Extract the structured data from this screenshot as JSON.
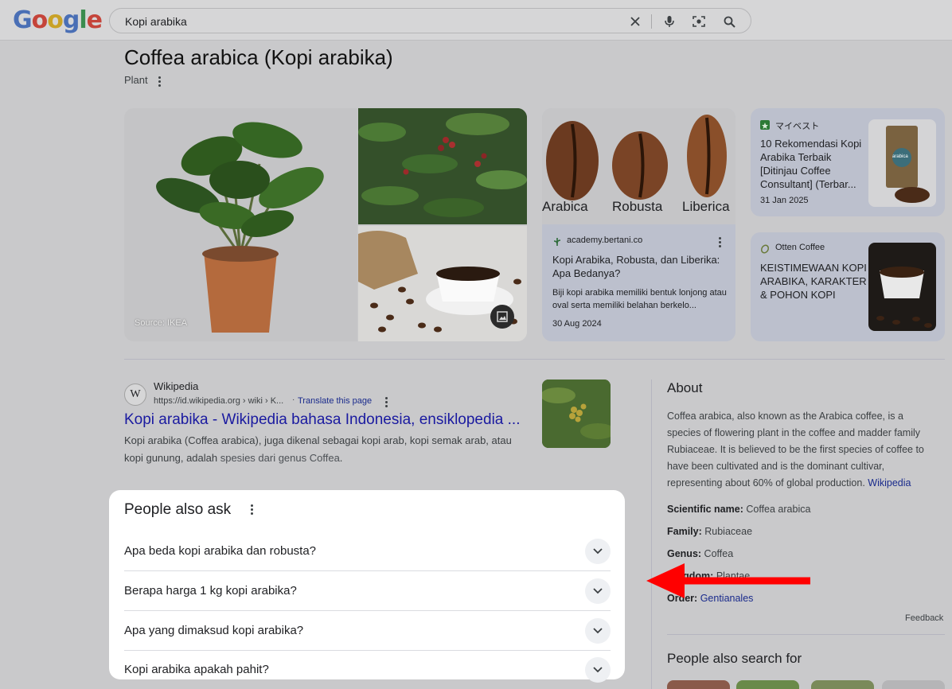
{
  "colors": {
    "overlay_bg": "#c9c9cb",
    "link": "#1a1aa0",
    "paa_bg": "#ffffff",
    "arrow": "#ff0000"
  },
  "logo": {
    "g1": "G",
    "o1": "o",
    "o2": "o",
    "g2": "g",
    "l": "l",
    "e": "e"
  },
  "search": {
    "value": "Kopi arabika",
    "icons": [
      "clear-icon",
      "mic-icon",
      "lens-icon",
      "search-icon"
    ]
  },
  "entity": {
    "title": "Coffea arabica (Kopi arabika)",
    "type": "Plant"
  },
  "image_caption": "Source: IKEA",
  "cards": [
    {
      "label_overlay": [
        "Arabica",
        "Robusta",
        "Liberica"
      ],
      "source": "academy.bertani.co",
      "title": "Kopi Arabika, Robusta, dan Liberika: Apa Bedanya?",
      "desc": "Biji kopi arabika memiliki bentuk lonjong atau oval serta memiliki belahan berkelo...",
      "date": "30 Aug 2024"
    },
    {
      "source": "マイベスト",
      "title": "10 Rekomendasi Kopi Arabika Terbaik [Ditinjau Coffee Consultant] (Terbar...",
      "date": "31 Jan 2025",
      "thumb_text": "arabica"
    },
    {
      "source": "Otten Coffee",
      "title": "KEISTIMEWAAN KOPI ARABIKA, KARAKTER & POHON KOPI"
    }
  ],
  "wiki": {
    "badge": "W",
    "site": "Wikipedia",
    "url": "https://id.wikipedia.org › wiki › K...",
    "translate": "Translate this page",
    "title": "Kopi arabika - Wikipedia bahasa Indonesia, ensiklopedia ...",
    "snippet_plain": "Kopi arabika (Coffea arabica), juga dikenal sebagai kopi arab, kopi semak arab, atau kopi gunung, adalah ",
    "snippet_bold": "spesies dari genus Coffea",
    "snippet_end": "."
  },
  "paa": {
    "heading": "People also ask",
    "questions": [
      "Apa beda kopi arabika dan robusta?",
      "Berapa harga 1 kg kopi arabika?",
      "Apa yang dimaksud kopi arabika?",
      "Kopi arabika apakah pahit?"
    ]
  },
  "about": {
    "heading": "About",
    "text": "Coffea arabica, also known as the Arabica coffee, is a species of flowering plant in the coffee and madder family Rubiaceae. It is believed to be the first species of coffee to have been cultivated and is the dominant cultivar, representing about 60% of global production. ",
    "link": "Wikipedia",
    "facts": [
      {
        "label": "Scientific name:",
        "value": "Coffea arabica"
      },
      {
        "label": "Family:",
        "value": "Rubiaceae"
      },
      {
        "label": "Genus:",
        "value": "Coffea"
      },
      {
        "label": "Kingdom:",
        "value": "Plantae"
      },
      {
        "label": "Order:",
        "value": "Gentianales"
      }
    ],
    "feedback": "Feedback",
    "also_search": "People also search for"
  }
}
